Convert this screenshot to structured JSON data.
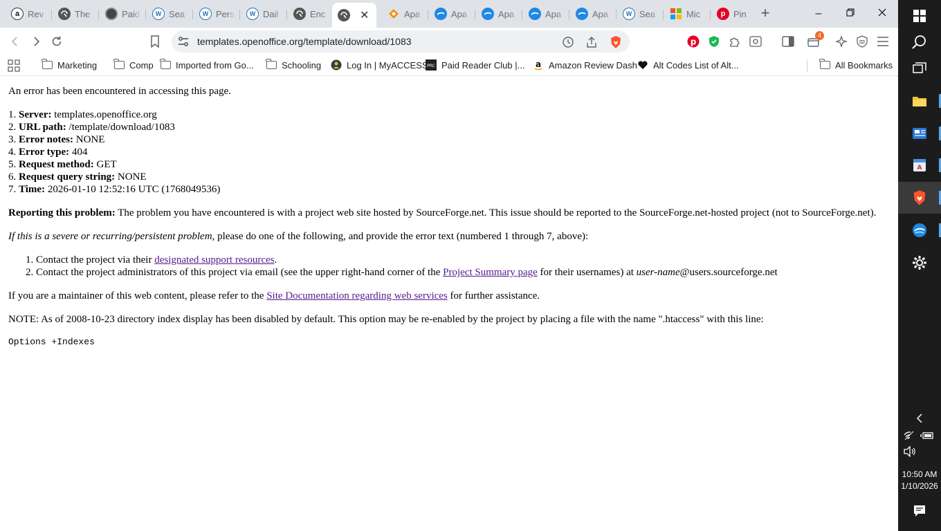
{
  "browser": {
    "tabs": [
      {
        "title": "Rev",
        "icon": "amazon-icon",
        "color": "#ffffff"
      },
      {
        "title": "The",
        "icon": "globe-icon",
        "color": "#555555"
      },
      {
        "title": "Paid",
        "icon": "badge-icon",
        "color": "#444444"
      },
      {
        "title": "Sea",
        "icon": "wordpress-icon",
        "color": "#2271b1"
      },
      {
        "title": "Pers",
        "icon": "wordpress-icon",
        "color": "#2271b1"
      },
      {
        "title": "Dail",
        "icon": "wordpress-icon",
        "color": "#2271b1"
      },
      {
        "title": "Enc",
        "icon": "globe-icon",
        "color": "#555555"
      },
      {
        "title": "",
        "icon": "globe-icon",
        "color": "#555555",
        "active": true
      },
      {
        "title": "Apa",
        "icon": "diamond-icon",
        "color": "#f29111"
      },
      {
        "title": "Apa",
        "icon": "openoffice-icon",
        "color": "#1e88e5"
      },
      {
        "title": "Apa",
        "icon": "openoffice-icon",
        "color": "#1e88e5"
      },
      {
        "title": "Apa",
        "icon": "openoffice-icon",
        "color": "#1e88e5"
      },
      {
        "title": "Apa",
        "icon": "openoffice-icon",
        "color": "#1e88e5"
      },
      {
        "title": "Sea",
        "icon": "wordpress-icon",
        "color": "#2271b1"
      },
      {
        "title": "Mic",
        "icon": "microsoft-icon",
        "color": "#f25022"
      },
      {
        "title": "Pin",
        "icon": "pinterest-icon",
        "color": "#e60023"
      }
    ],
    "url": "templates.openoffice.org/template/download/1083",
    "bookmarks": [
      {
        "label": "Marketing",
        "icon": "folder-icon"
      },
      {
        "label": "Comp",
        "icon": "folder-icon"
      },
      {
        "label": "Imported from Go...",
        "icon": "folder-icon"
      },
      {
        "label": "Schooling",
        "icon": "folder-icon"
      },
      {
        "label": "Log In | MyACCESS",
        "icon": "myaccess-icon"
      },
      {
        "label": "Paid Reader Club |...",
        "icon": "prc-icon"
      },
      {
        "label": "Amazon Review Dash",
        "icon": "amazon-icon"
      },
      {
        "label": "Alt Codes List of Alt...",
        "icon": "heart-icon"
      }
    ],
    "all_bookmarks": "All Bookmarks",
    "extension_badge": "4"
  },
  "page": {
    "intro": "An error has been encountered in accessing this page.",
    "info": [
      {
        "num": "1.",
        "label": "Server:",
        "value": "templates.openoffice.org"
      },
      {
        "num": "2.",
        "label": "URL path:",
        "value": "/template/download/1083"
      },
      {
        "num": "3.",
        "label": "Error notes:",
        "value": "NONE"
      },
      {
        "num": "4.",
        "label": "Error type:",
        "value": "404"
      },
      {
        "num": "5.",
        "label": "Request method:",
        "value": "GET"
      },
      {
        "num": "6.",
        "label": "Request query string:",
        "value": "NONE"
      },
      {
        "num": "7.",
        "label": "Time:",
        "value": "2026-01-10 12:52:16 UTC (1768049536)"
      }
    ],
    "reporting_label": "Reporting this problem:",
    "reporting_text": "The problem you have encountered is with a project web site hosted by SourceForge.net. This issue should be reported to the SourceForge.net-hosted project (not to SourceForge.net).",
    "severe_italic": "If this is a severe or recurring/persistent problem,",
    "severe_text": "please do one of the following, and provide the error text (numbered 1 through 7, above):",
    "step1_pre": "Contact the project via their ",
    "step1_link": "designated support resources",
    "step1_post": ".",
    "step2_pre": "Contact the project administrators of this project via email (see the upper right-hand corner of the ",
    "step2_link": "Project Summary page",
    "step2_mid": " for their usernames) at ",
    "step2_italic": "user-name",
    "step2_post": "@users.sourceforge.net",
    "maint_pre": "If you are a maintainer of this web content, please refer to the ",
    "maint_link": "Site Documentation regarding web services",
    "maint_post": " for further assistance.",
    "note": "NOTE: As of 2008-10-23 directory index display has been disabled by default. This option may be re-enabled by the project by placing a file with the name \".htaccess\" with this line:",
    "code": "Options +Indexes"
  },
  "taskbar": {
    "time": "10:50 AM",
    "date": "1/10/2026"
  }
}
